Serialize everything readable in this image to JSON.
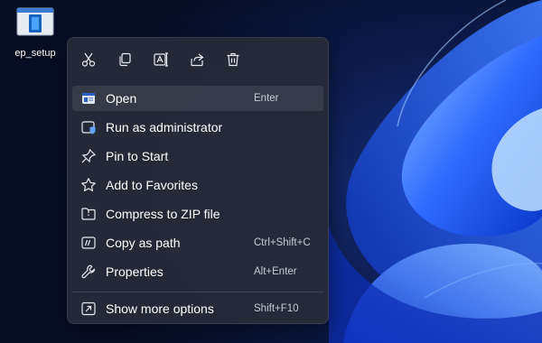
{
  "desktop": {
    "icon_label": "ep_setup",
    "icon": "installer-file-icon"
  },
  "context_menu": {
    "toolbar": [
      {
        "name": "cut",
        "icon": "scissors-icon"
      },
      {
        "name": "copy",
        "icon": "copy-icon"
      },
      {
        "name": "rename",
        "icon": "rename-icon"
      },
      {
        "name": "share",
        "icon": "share-icon"
      },
      {
        "name": "delete",
        "icon": "trash-icon"
      }
    ],
    "items": [
      {
        "label": "Open",
        "shortcut": "Enter",
        "icon": "open-window-icon",
        "highlighted": true
      },
      {
        "label": "Run as administrator",
        "shortcut": "",
        "icon": "admin-shield-icon"
      },
      {
        "label": "Pin to Start",
        "shortcut": "",
        "icon": "pin-icon"
      },
      {
        "label": "Add to Favorites",
        "shortcut": "",
        "icon": "star-icon"
      },
      {
        "label": "Compress to ZIP file",
        "shortcut": "",
        "icon": "zip-folder-icon"
      },
      {
        "label": "Copy as path",
        "shortcut": "Ctrl+Shift+C",
        "icon": "copy-path-icon"
      },
      {
        "label": "Properties",
        "shortcut": "Alt+Enter",
        "icon": "wrench-icon"
      },
      {
        "label": "Show more options",
        "shortcut": "Shift+F10",
        "icon": "show-more-icon"
      }
    ]
  },
  "colors": {
    "accent": "#60a5fa",
    "menu_background": "#262a38",
    "text": "#ffffff",
    "shortcut_text": "#c9ccd4"
  }
}
